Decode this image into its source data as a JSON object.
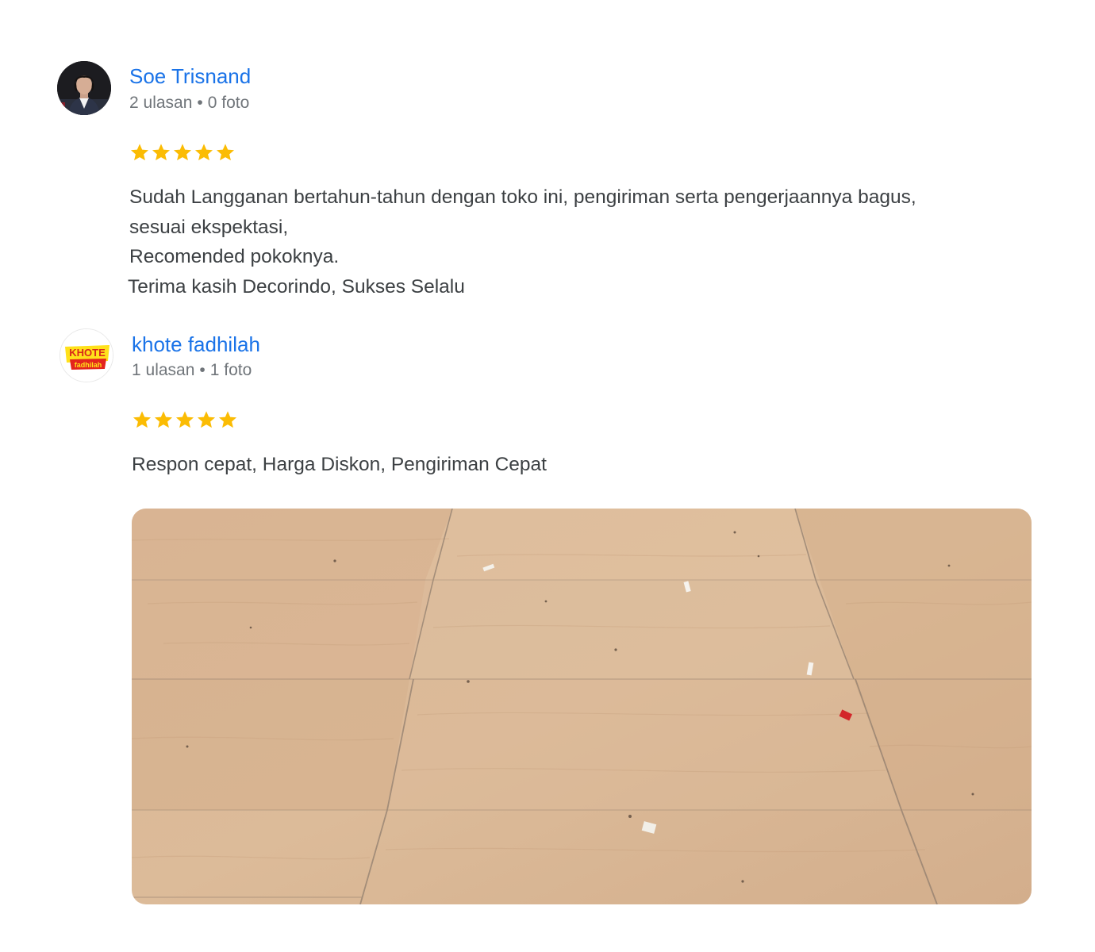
{
  "reviews": [
    {
      "author": "Soe Trisnand",
      "reviews_count": "2 ulasan",
      "photos_count": "0 foto",
      "separator": "•",
      "rating": 5,
      "text_lines": [
        "Sudah Langganan bertahun-tahun dengan toko ini, pengiriman serta pengerjaannya bagus,",
        "sesuai ekspektasi,",
        "Recomended pokoknya.",
        "Terima kasih Decorindo, Sukses Selalu"
      ]
    },
    {
      "author": "khote fadhilah",
      "reviews_count": "1 ulasan",
      "photos_count": "1 foto",
      "separator": "•",
      "rating": 5,
      "avatar_logo_top": "KHOTE",
      "avatar_logo_bottom": "fadhilah",
      "text_lines": [
        "Respon cepat, Harga Diskon, Pengiriman Cepat"
      ]
    }
  ],
  "colors": {
    "author_link": "#1a73e8",
    "star": "#fbbc04",
    "meta": "#70757a",
    "text": "#3c4043"
  }
}
